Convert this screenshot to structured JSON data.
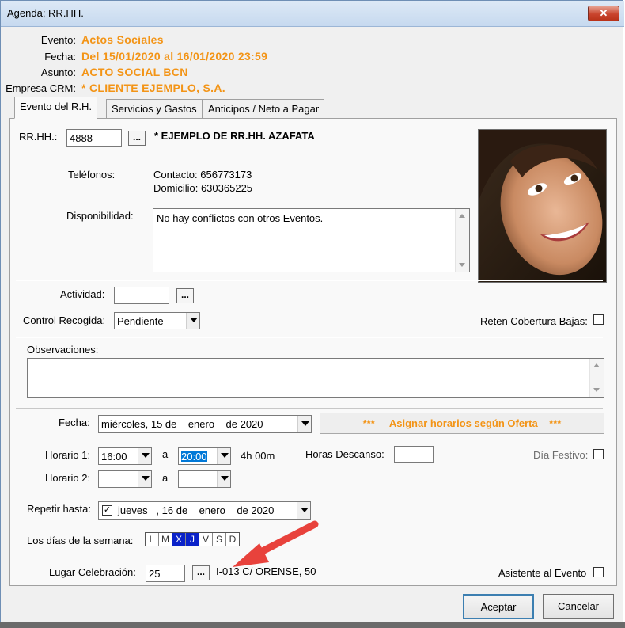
{
  "window": {
    "title": "Agenda; RR.HH.",
    "close_glyph": "✕"
  },
  "header": {
    "evento_label": "Evento:",
    "evento_value": "Actos Sociales",
    "fecha_label": "Fecha:",
    "fecha_value": "Del 15/01/2020 al 16/01/2020 23:59",
    "asunto_label": "Asunto:",
    "asunto_value": "ACTO SOCIAL BCN",
    "empresa_label": "Empresa CRM:",
    "empresa_value": "* CLIENTE EJEMPLO, S.A."
  },
  "tabs": [
    {
      "label": "Evento del R.H.",
      "active": true
    },
    {
      "label": "Servicios y Gastos",
      "active": false
    },
    {
      "label": "Anticipos / Neto a Pagar",
      "active": false
    }
  ],
  "rrhh": {
    "label": "RR.HH.:",
    "code": "4888",
    "browse": "...",
    "name": "* EJEMPLO DE RR.HH. AZAFATA",
    "telefonos_label": "Teléfonos:",
    "contacto": "Contacto: 656773173",
    "domicilio": "Domicilio: 630365225",
    "disponibilidad_label": "Disponibilidad:",
    "disponibilidad_text": "No hay conflictos con otros Eventos."
  },
  "actividad": {
    "label": "Actividad:",
    "value": "",
    "browse": "..."
  },
  "control_recogida": {
    "label": "Control Recogida:",
    "value": "Pendiente"
  },
  "reten": {
    "label": "Reten Cobertura Bajas:",
    "checked": false
  },
  "observaciones": {
    "label": "Observaciones:",
    "value": ""
  },
  "schedule": {
    "fecha_label": "Fecha:",
    "fecha_value": "miércoles, 15 de    enero    de 2020",
    "asignar_prefix": "***",
    "asignar_label_start": "Asignar horarios según ",
    "asignar_label_link": "Oferta",
    "asignar_suffix": "***",
    "horario1_label": "Horario 1:",
    "horario1_from": "16:00",
    "a1": "a",
    "horario1_to": "20:00",
    "duration": "4h 00m",
    "horas_descanso_label": "Horas Descanso:",
    "horas_descanso_value": "",
    "dia_festivo_label": "Día Festivo:",
    "horario2_label": "Horario 2:",
    "horario2_from": "",
    "a2": "a",
    "horario2_to": "",
    "repetir_label": "Repetir hasta:",
    "repetir_checked": true,
    "repetir_value": "jueves   , 16 de    enero    de 2020",
    "dias_label": "Los días de la semana:",
    "dias": [
      {
        "letter": "L",
        "selected": false
      },
      {
        "letter": "M",
        "selected": false
      },
      {
        "letter": "X",
        "selected": true
      },
      {
        "letter": "J",
        "selected": true
      },
      {
        "letter": "V",
        "selected": false
      },
      {
        "letter": "S",
        "selected": false
      },
      {
        "letter": "D",
        "selected": false
      }
    ],
    "lugar_label": "Lugar Celebración:",
    "lugar_code": "25",
    "lugar_browse": "...",
    "lugar_text": "I-013 C/ ORENSE, 50",
    "asistente_label": "Asistente al Evento"
  },
  "buttons": {
    "aceptar": "Aceptar",
    "cancelar_underline": "C",
    "cancelar_rest": "ancelar"
  },
  "colors": {
    "accent": "#f39416",
    "selected_day": "#0a22c9",
    "arrow": "#e8423c"
  }
}
